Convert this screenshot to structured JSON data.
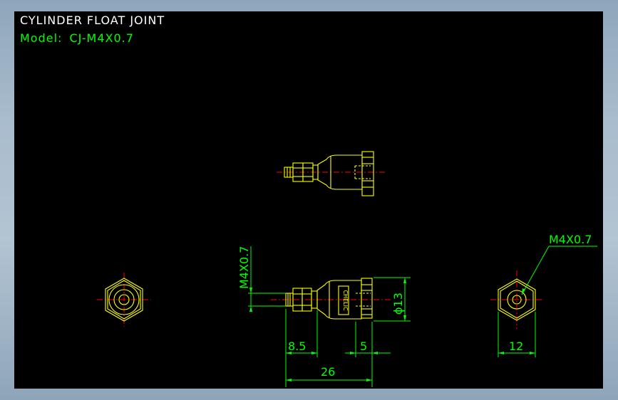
{
  "drawing": {
    "title": "CYLINDER FLOAT JOINT",
    "model_label": "Model:",
    "model_value": "CJ-M4X0.7"
  },
  "dimensions": {
    "thread_vertical": "M4X0.7",
    "thread_leader": "M4X0.7",
    "diameter": "ϕ13",
    "length_8_5": "8.5",
    "length_5": "5",
    "length_26": "26",
    "width_12": "12"
  },
  "colors": {
    "background": "#000000",
    "outline": "#ffff00",
    "dimension": "#00ff00",
    "centerline": "#ff0000"
  }
}
